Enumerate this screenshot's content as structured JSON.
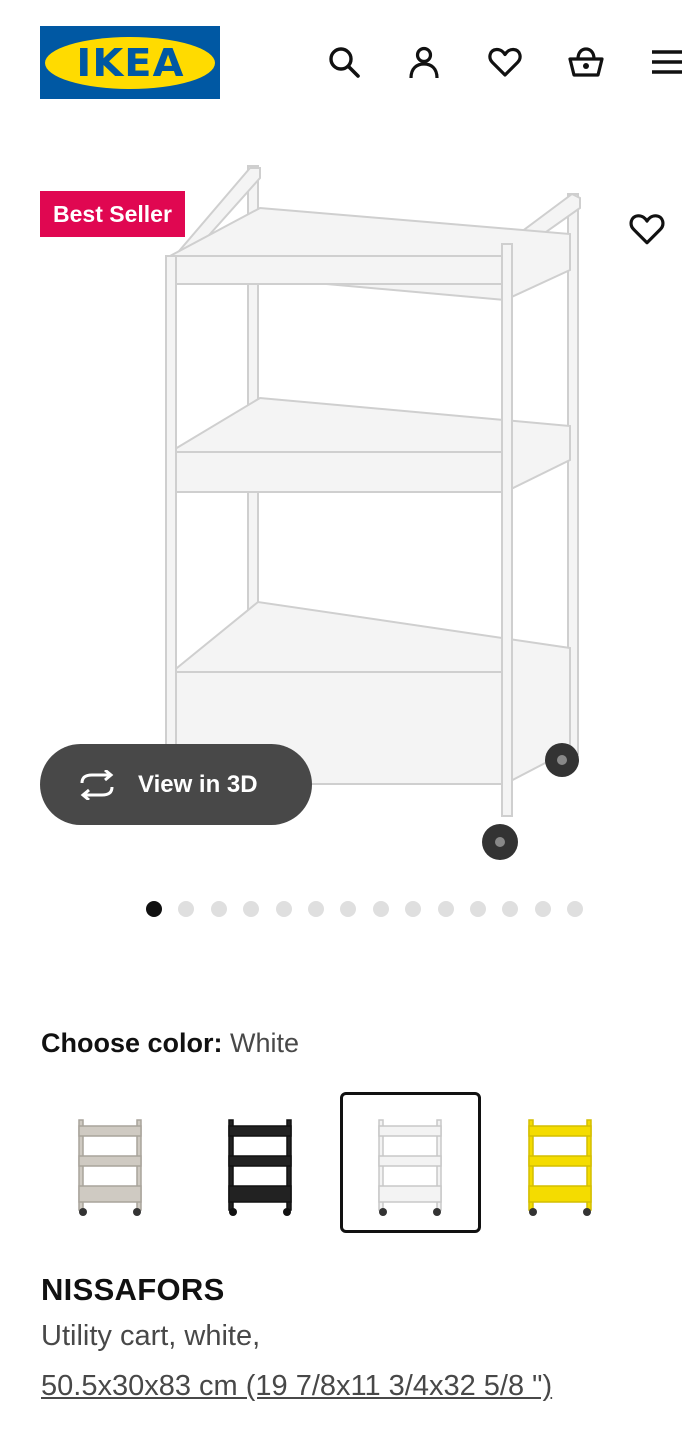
{
  "header": {
    "logo_text": "IKEA",
    "icons": [
      "search-icon",
      "account-icon",
      "heart-icon",
      "basket-icon",
      "menu-icon"
    ]
  },
  "gallery": {
    "badge": "Best Seller",
    "view_3d_label": "View in 3D",
    "dot_count": 14,
    "active_dot": 0
  },
  "colors": {
    "label": "Choose color:",
    "selected_value": "White",
    "swatches": [
      {
        "name": "beige",
        "color": "#cfcac2"
      },
      {
        "name": "black",
        "color": "#222222"
      },
      {
        "name": "white",
        "color": "#eeeeee",
        "selected": true
      },
      {
        "name": "yellow",
        "color": "#f4dc00"
      }
    ]
  },
  "product": {
    "name": "NISSAFORS",
    "description": "Utility cart, white,",
    "size": "50.5x30x83 cm (19 7/8x11 3/4x32 5/8 \")"
  },
  "theme": {
    "brand_blue": "#0058A3",
    "brand_yellow": "#FFDB00",
    "badge_red": "#E00751",
    "button_gray": "#484848"
  }
}
